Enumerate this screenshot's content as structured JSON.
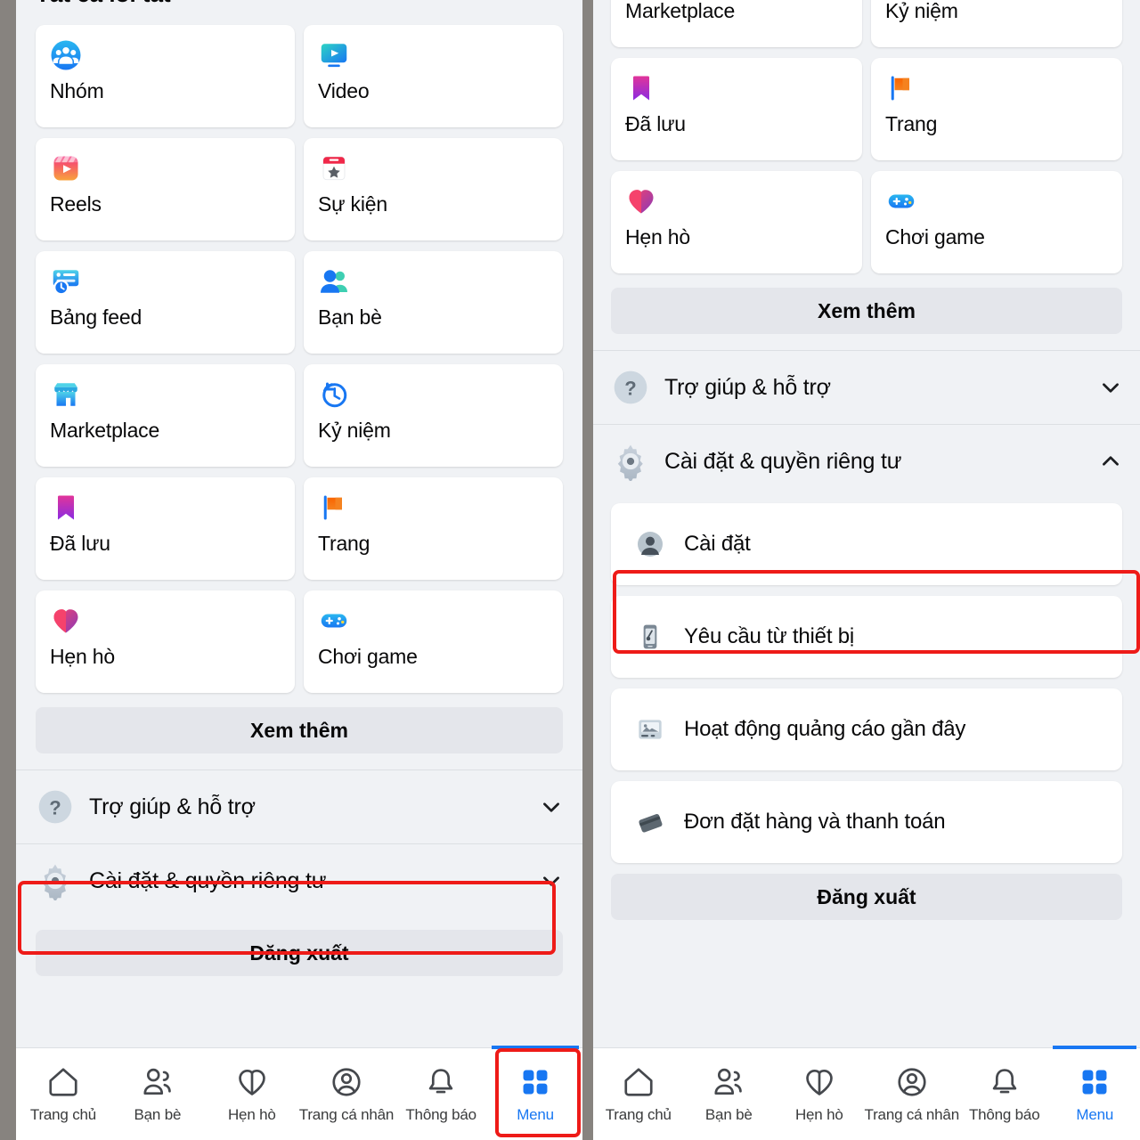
{
  "app": {
    "heading_partial": "Tất cả lối tắt"
  },
  "left_panel": {
    "shortcuts": [
      {
        "label": "Nhóm",
        "icon": "groups-icon"
      },
      {
        "label": "Video",
        "icon": "video-icon"
      },
      {
        "label": "Reels",
        "icon": "reels-icon"
      },
      {
        "label": "Sự kiện",
        "icon": "events-icon"
      },
      {
        "label": "Bảng feed",
        "icon": "feeds-icon"
      },
      {
        "label": "Bạn bè",
        "icon": "friends-icon"
      },
      {
        "label": "Marketplace",
        "icon": "marketplace-icon"
      },
      {
        "label": "Kỷ niệm",
        "icon": "memories-icon"
      },
      {
        "label": "Đã lưu",
        "icon": "saved-icon"
      },
      {
        "label": "Trang",
        "icon": "pages-icon"
      },
      {
        "label": "Hẹn hò",
        "icon": "dating-icon"
      },
      {
        "label": "Chơi game",
        "icon": "gaming-icon"
      }
    ],
    "see_more_label": "Xem thêm",
    "accordions": [
      {
        "label": "Trợ giúp & hỗ trợ",
        "icon": "help-icon",
        "state": "collapsed",
        "chevron": "chevron-down-icon"
      },
      {
        "label": "Cài đặt & quyền riêng tư",
        "icon": "settings-gear-icon",
        "state": "collapsed",
        "chevron": "chevron-down-icon"
      }
    ],
    "logout_label": "Đăng xuất",
    "highlight_color": "#ee1b18"
  },
  "right_panel": {
    "shortcuts": [
      {
        "label": "Marketplace",
        "icon": "marketplace-icon"
      },
      {
        "label": "Kỷ niệm",
        "icon": "memories-icon"
      },
      {
        "label": "Đã lưu",
        "icon": "saved-icon"
      },
      {
        "label": "Trang",
        "icon": "pages-icon"
      },
      {
        "label": "Hẹn hò",
        "icon": "dating-icon"
      },
      {
        "label": "Chơi game",
        "icon": "gaming-icon"
      }
    ],
    "see_more_label": "Xem thêm",
    "accordions": [
      {
        "label": "Trợ giúp & hỗ trợ",
        "icon": "help-icon",
        "state": "collapsed",
        "chevron": "chevron-down-icon"
      },
      {
        "label": "Cài đặt & quyền riêng tư",
        "icon": "settings-gear-icon",
        "state": "expanded",
        "chevron": "chevron-up-icon"
      }
    ],
    "settings_submenu": [
      {
        "label": "Cài đặt",
        "icon": "account-avatar-icon",
        "highlighted": true
      },
      {
        "label": "Yêu cầu từ thiết bị",
        "icon": "device-request-icon",
        "highlighted": false
      },
      {
        "label": "Hoạt động quảng cáo gần đây",
        "icon": "ad-activity-icon",
        "highlighted": false
      },
      {
        "label": "Đơn đặt hàng và thanh toán",
        "icon": "payments-card-icon",
        "highlighted": false
      }
    ],
    "logout_label": "Đăng xuất"
  },
  "bottom_nav": {
    "items": [
      {
        "label": "Trang chủ",
        "icon": "home-icon",
        "active": false
      },
      {
        "label": "Bạn bè",
        "icon": "friends-nav-icon",
        "active": false
      },
      {
        "label": "Hẹn hò",
        "icon": "dating-nav-icon",
        "active": false
      },
      {
        "label": "Trang cá nhân",
        "icon": "profile-nav-icon",
        "active": false
      },
      {
        "label": "Thông báo",
        "icon": "bell-icon",
        "active": false
      },
      {
        "label": "Menu",
        "icon": "menu-grid-icon",
        "active": true
      }
    ],
    "active_color": "#1877f2"
  }
}
